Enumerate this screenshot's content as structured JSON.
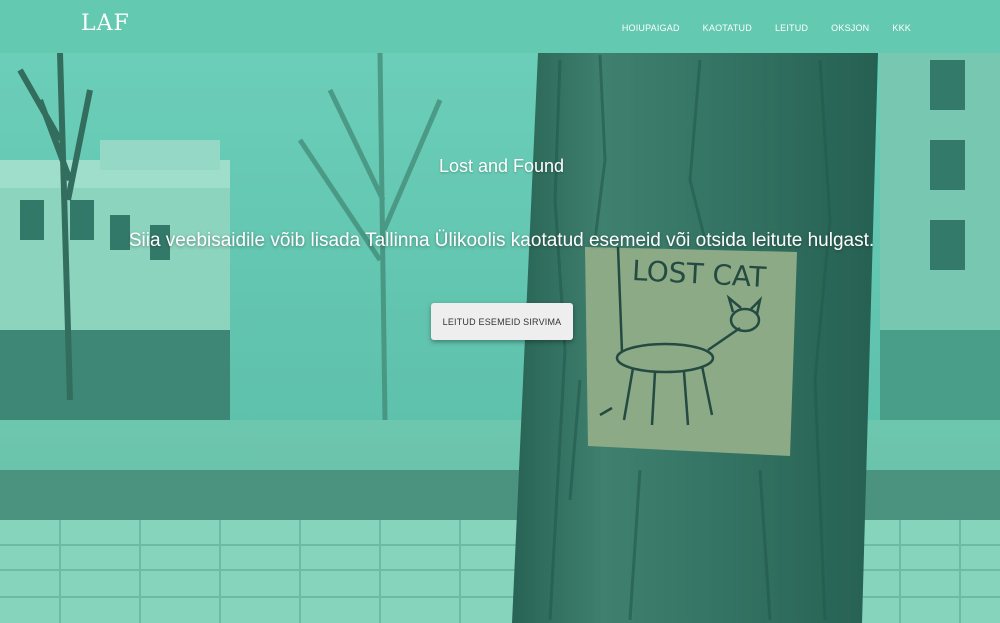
{
  "navbar": {
    "brand": "LAF",
    "links": [
      {
        "label": "HOIUPAIGAD"
      },
      {
        "label": "KAOTATUD"
      },
      {
        "label": "LEITUD"
      },
      {
        "label": "OKSJON"
      },
      {
        "label": "KKK"
      }
    ]
  },
  "hero": {
    "title": "Lost and Found",
    "subtitle": "Siia veebisaidile võib lisada Tallinna Ülikoolis kaotatud esemeid või otsida leitute hulgast.",
    "button_label": "LEITUD ESEMEID SIRVIMA",
    "background_image": "Tree trunk with a hand-drawn lost cat sign",
    "sign_text": "LOST CAT"
  },
  "colors": {
    "navbar": "#63c9b0",
    "overlay": "#40c8aa",
    "button": "#eeeeee",
    "text": "#ffffff"
  }
}
